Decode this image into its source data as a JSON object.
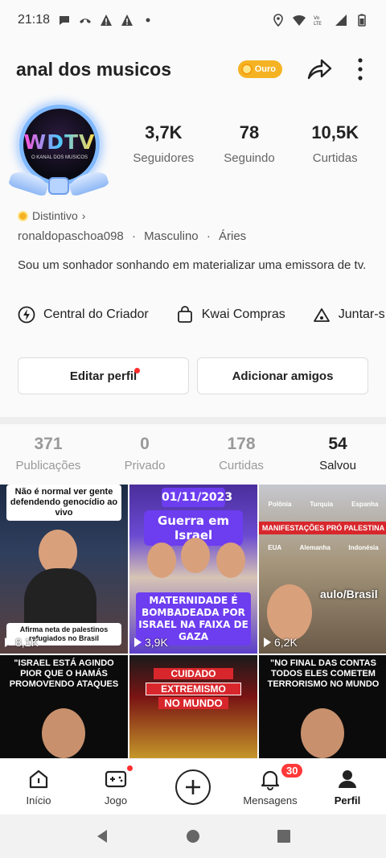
{
  "status_bar": {
    "time": "21:18"
  },
  "header": {
    "title": "anal dos musicos",
    "badge_label": "Ouro"
  },
  "avatar": {
    "logo_text": "WDTV",
    "subtitle": "O KANAL DOS MUSICOS"
  },
  "stats": [
    {
      "value": "3,7K",
      "label": "Seguidores"
    },
    {
      "value": "78",
      "label": "Seguindo"
    },
    {
      "value": "10,5K",
      "label": "Curtidas"
    }
  ],
  "profile": {
    "tag": "Distintivo",
    "username": "ronaldopaschoa098",
    "gender": "Masculino",
    "sign": "Áries",
    "separator": "·",
    "bio": "Sou um sonhador sonhando em materializar uma emissora de tv."
  },
  "shortcuts": [
    {
      "label": "Central do Criador",
      "icon": "lightning-icon"
    },
    {
      "label": "Kwai Compras",
      "icon": "shopping-bag-icon"
    },
    {
      "label": "Juntar-s",
      "icon": "tent-icon"
    }
  ],
  "buttons": {
    "edit": "Editar perfil",
    "add_friends": "Adicionar amigos"
  },
  "tabs": [
    {
      "count": "371",
      "label": "Publicações",
      "active": false
    },
    {
      "count": "0",
      "label": "Privado",
      "active": false
    },
    {
      "count": "178",
      "label": "Curtidas",
      "active": false
    },
    {
      "count": "54",
      "label": "Salvou",
      "active": true
    }
  ],
  "videos": [
    {
      "title": "Não é normal ver gente defendendo genocídio ao vivo",
      "caption": "Afirma neta de palestinos refugiados no Brasil",
      "views": "8,1K"
    },
    {
      "date": "01/11/2023",
      "title": "Guerra em Israel",
      "caption": "MATERNIDADE É BOMBADEADA POR ISRAEL NA FAIXA DE GAZA",
      "views": "3,9K"
    },
    {
      "labels": [
        "Polônia",
        "Turquia",
        "Espanha"
      ],
      "banner": "MANIFESTAÇÕES PRÓ PALESTINA",
      "labels2": [
        "EUA",
        "Alemanha",
        "Indonésia"
      ],
      "overlay": "aulo/Brasil",
      "views": "6,2K"
    },
    {
      "title": "\"ISRAEL ESTÁ AGINDO PIOR QUE O HAMÁS PROMOVENDO ATAQUES"
    },
    {
      "warning": "CUIDADO",
      "title1": "EXTREMISMO",
      "title2": "NO MUNDO"
    },
    {
      "title": "\"NO FINAL DAS CONTAS TODOS ELES COMETEM TERRORISMO NO MUNDO"
    }
  ],
  "bottom_nav": [
    {
      "label": "Início",
      "icon": "home-icon"
    },
    {
      "label": "Jogo",
      "icon": "gamepad-icon"
    },
    {
      "label": "",
      "icon": "plus-icon"
    },
    {
      "label": "Mensagens",
      "icon": "bell-icon",
      "badge": "30"
    },
    {
      "label": "Perfil",
      "icon": "person-icon"
    }
  ],
  "colors": {
    "accent": "#ff2d2d",
    "gold": "#f5b324",
    "purple": "#6d3df0"
  }
}
